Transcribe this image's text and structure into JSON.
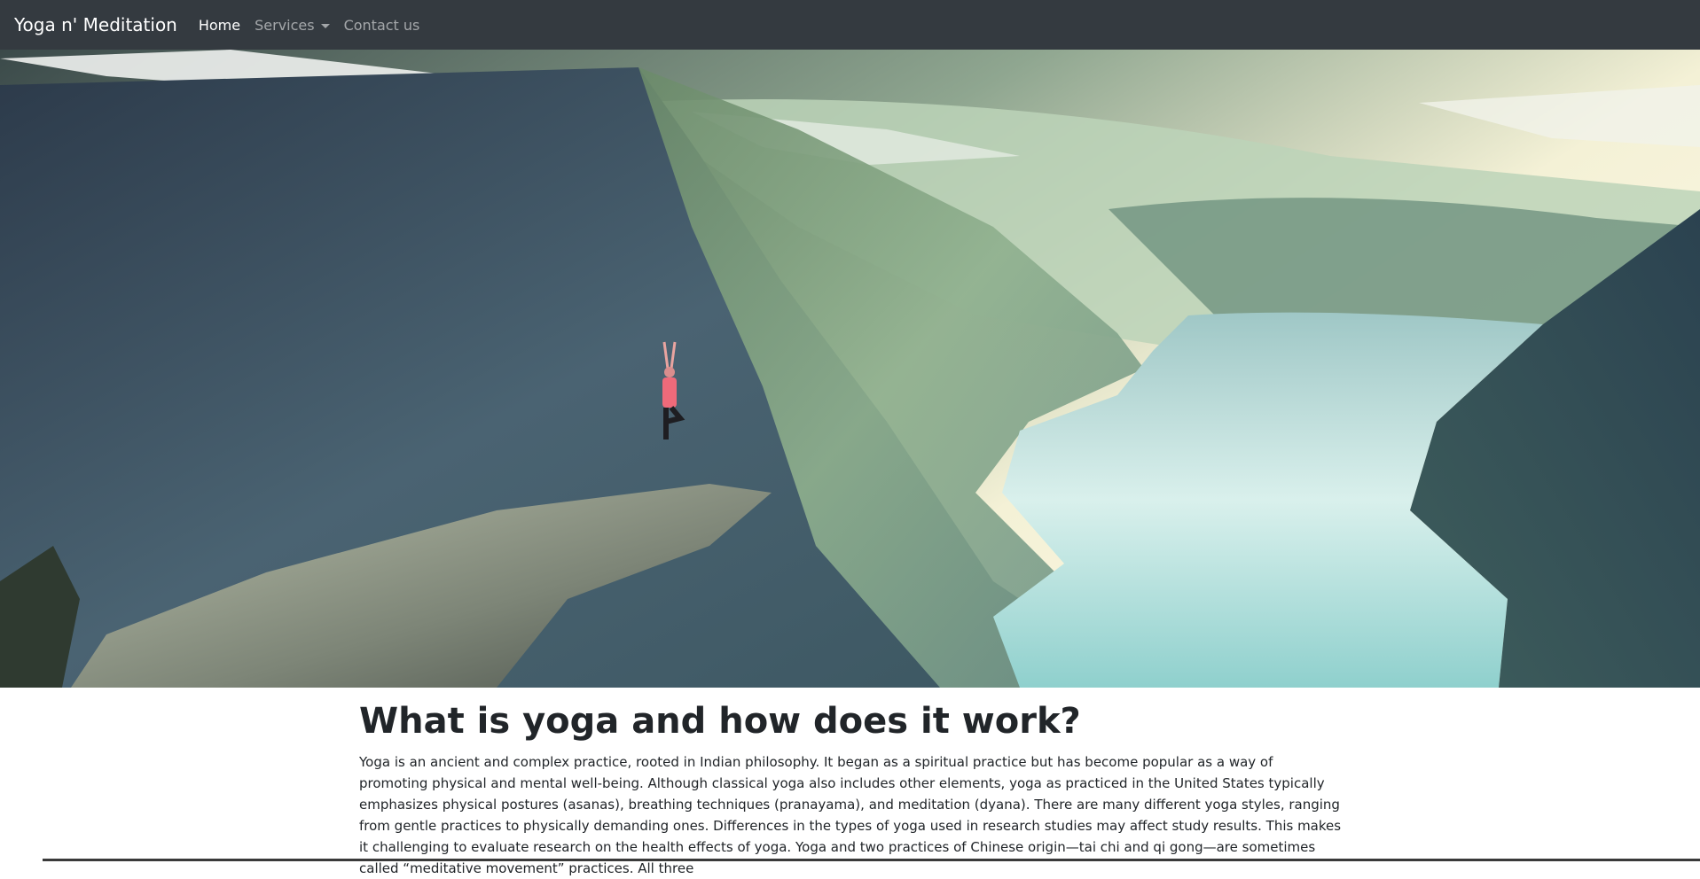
{
  "navbar": {
    "brand": "Yoga n' Meditation",
    "links": {
      "home": "Home",
      "services": "Services",
      "contact": "Contact us"
    },
    "active": "home"
  },
  "hero": {
    "image_icon": "mountain-lake-yoga-photo"
  },
  "article": {
    "heading": "What is yoga and how does it work?",
    "body": "Yoga is an ancient and complex practice, rooted in Indian philosophy. It began as a spiritual practice but has become popular as a way of promoting physical and mental well-being. Although classical yoga also includes other elements, yoga as practiced in the United States typically emphasizes physical postures (asanas), breathing techniques (pranayama), and meditation (dyana). There are many different yoga styles, ranging from gentle practices to physically demanding ones. Differences in the types of yoga used in research studies may affect study results. This makes it challenging to evaluate research on the health effects of yoga. Yoga and two practices of Chinese origin—tai chi and qi gong—are sometimes called “meditative movement” practices. All three"
  },
  "colors": {
    "navbar_bg": "#343a40",
    "text": "#212529",
    "nav_muted": "rgba(255,255,255,0.55)"
  }
}
